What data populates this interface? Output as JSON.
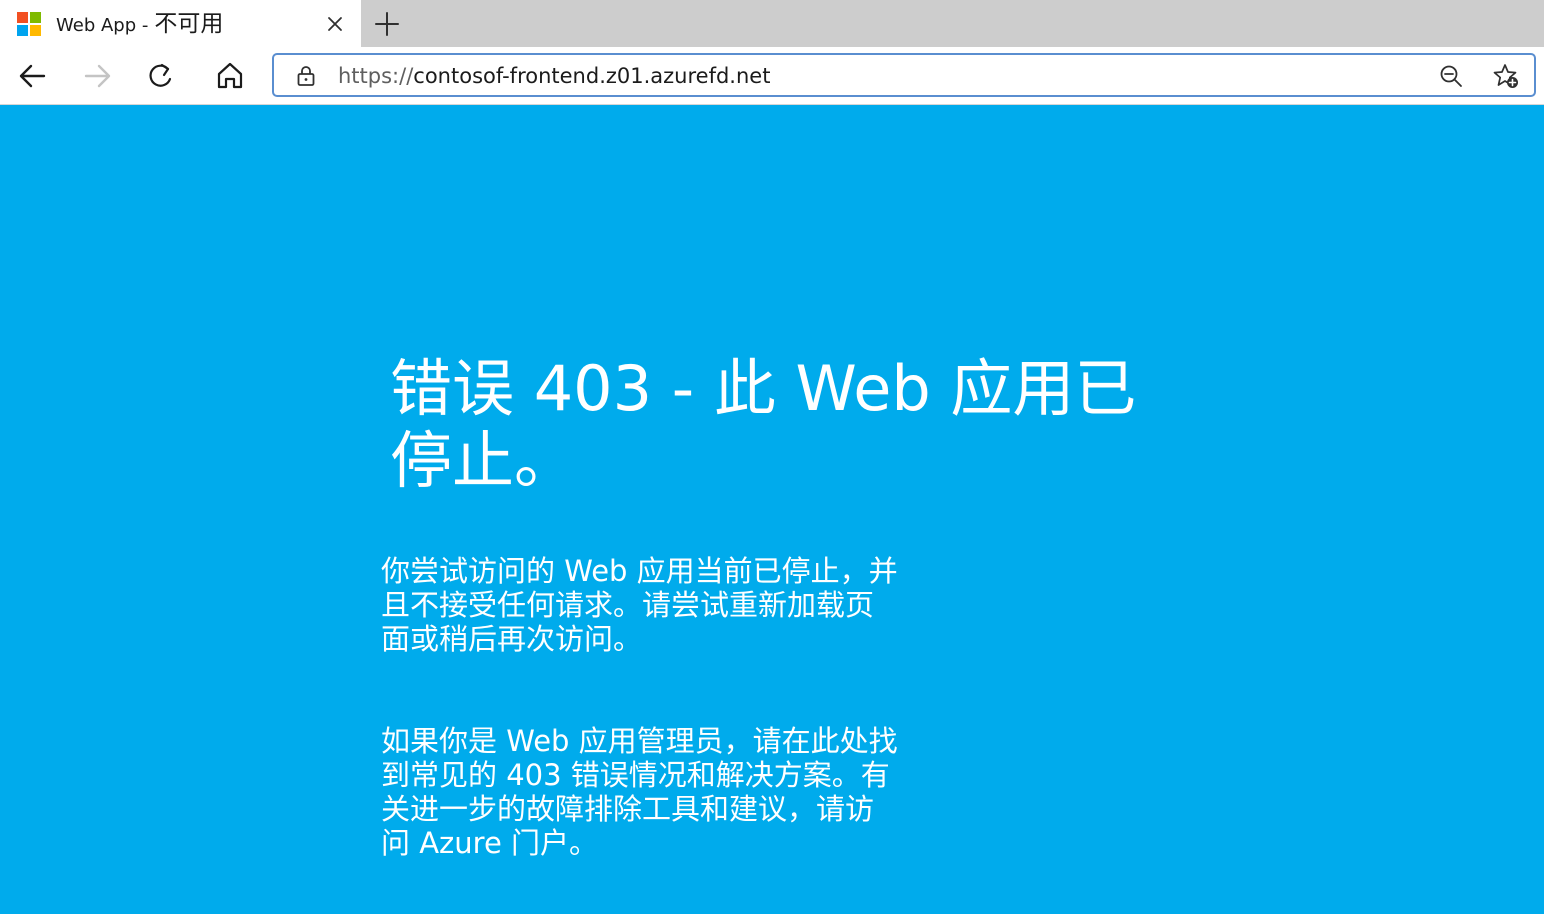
{
  "browser": {
    "tab": {
      "title_prefix": "Web App -",
      "title_cjk": "不可用",
      "favicon": "microsoft-logo",
      "close_icon": "close-icon"
    },
    "new_tab_icon": "plus-icon",
    "nav": {
      "back_icon": "arrow-left-icon",
      "forward_icon": "arrow-right-icon",
      "refresh_icon": "refresh-icon",
      "home_icon": "home-icon"
    },
    "address": {
      "scheme": "https://",
      "host": "contosof-frontend.z01.azurefd.net",
      "lock_icon": "lock-icon",
      "zoom_icon": "zoom-out-icon",
      "favorites_icon": "add-favorite-icon"
    }
  },
  "page": {
    "background_color": "#00abec",
    "heading": "错误 403 - 此 Web 应用已停止。",
    "paragraph1": "你尝试访问的 Web 应用当前已停止，并且不接受任何请求。请尝试重新加载页面或稍后再次访问。",
    "paragraph2": "如果你是 Web 应用管理员，请在此处找到常见的 403 错误情况和解决方案。有关进一步的故障排除工具和建议，请访问 Azure 门户。"
  }
}
